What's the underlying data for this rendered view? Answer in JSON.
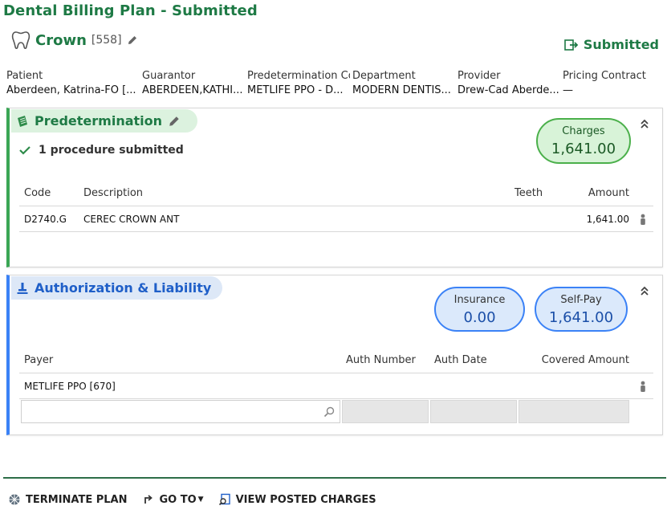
{
  "header": {
    "title": "Dental Billing Plan - Submitted",
    "plan_name": "Crown",
    "plan_id": "[558]",
    "status": "Submitted"
  },
  "info": [
    {
      "label": "Patient",
      "value": "Aberdeen, Katrina-FO [..."
    },
    {
      "label": "Guarantor",
      "value": "ABERDEEN,KATHI..."
    },
    {
      "label": "Predetermination Co",
      "value": "METLIFE PPO - D..."
    },
    {
      "label": "Department",
      "value": "MODERN DENTIS..."
    },
    {
      "label": "Provider",
      "value": "Drew-Cad Aberde..."
    },
    {
      "label": "Pricing Contract",
      "value": "—"
    }
  ],
  "predetermination": {
    "title": "Predetermination",
    "submitted_text": "1 procedure submitted",
    "charges_label": "Charges",
    "charges_value": "1,641.00",
    "columns": {
      "code": "Code",
      "description": "Description",
      "teeth": "Teeth",
      "amount": "Amount"
    },
    "rows": [
      {
        "code": "D2740.G",
        "description": "CEREC CROWN ANT",
        "teeth": "",
        "amount": "1,641.00"
      }
    ]
  },
  "authorization": {
    "title": "Authorization & Liability",
    "insurance_label": "Insurance",
    "insurance_value": "0.00",
    "selfpay_label": "Self-Pay",
    "selfpay_value": "1,641.00",
    "columns": {
      "payer": "Payer",
      "auth_number": "Auth Number",
      "auth_date": "Auth Date",
      "covered_amount": "Covered Amount"
    },
    "rows": [
      {
        "payer": "METLIFE PPO [670]",
        "auth_number": "",
        "auth_date": "",
        "covered_amount": ""
      }
    ],
    "search_value": ""
  },
  "footer": {
    "terminate_label": "TERMINATE PLAN",
    "goto_label": "GO TO",
    "view_charges_label": "VIEW POSTED CHARGES"
  },
  "colors": {
    "brand_green": "#1e7a45",
    "accent_blue": "#3b82f6"
  }
}
